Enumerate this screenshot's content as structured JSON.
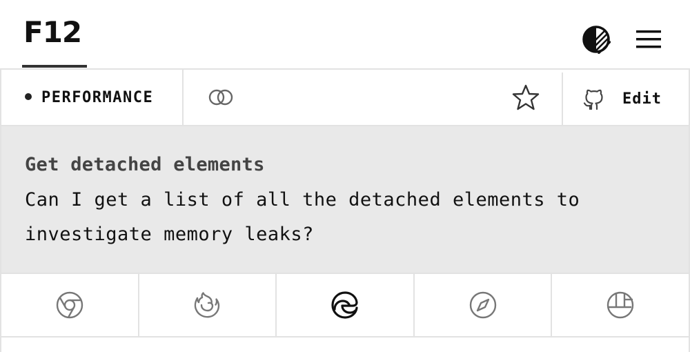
{
  "header": {
    "logo": "F12",
    "theme_toggle_icon": "contrast-icon",
    "menu_icon": "hamburger-menu-icon"
  },
  "toolbar": {
    "category_label": "PERFORMANCE",
    "link_icon": "link-icon",
    "star_icon": "star-icon",
    "edit_icon": "github-icon",
    "edit_label": "Edit"
  },
  "content": {
    "title": "Get detached elements",
    "description": "Can I get a list of all the detached elements to investigate memory leaks?"
  },
  "browsers": {
    "tabs": [
      {
        "icon": "chrome-icon",
        "selected": false
      },
      {
        "icon": "firefox-icon",
        "selected": false
      },
      {
        "icon": "edge-icon",
        "selected": true
      },
      {
        "icon": "safari-icon",
        "selected": false
      },
      {
        "icon": "polypane-icon",
        "selected": false
      }
    ]
  },
  "colors": {
    "text": "#111111",
    "muted_icon": "#777777",
    "border": "#e2e2e2",
    "panel_bg": "#e9e9e9"
  }
}
